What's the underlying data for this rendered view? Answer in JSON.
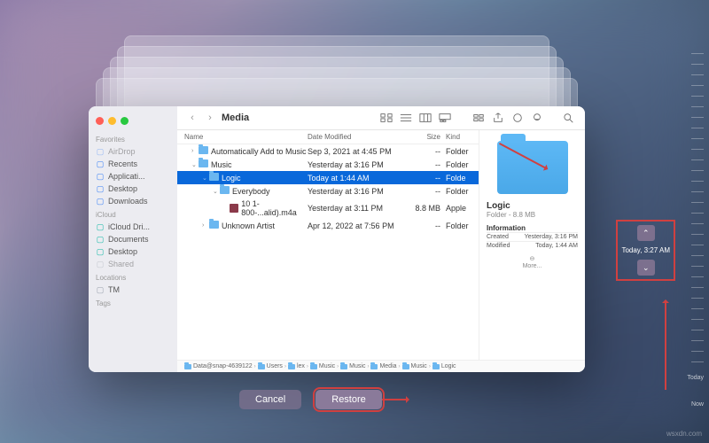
{
  "window_title": "Media",
  "traffic": {
    "close": "#ff5f57",
    "min": "#febc2e",
    "max": "#28c840"
  },
  "sidebar": {
    "favorites_head": "Favorites",
    "favorites": [
      {
        "label": "AirDrop",
        "color": "#3b82f6",
        "dim": true
      },
      {
        "label": "Recents",
        "color": "#3b82f6"
      },
      {
        "label": "Applicati...",
        "color": "#3b82f6"
      },
      {
        "label": "Desktop",
        "color": "#3b82f6"
      },
      {
        "label": "Downloads",
        "color": "#3b82f6"
      }
    ],
    "icloud_head": "iCloud",
    "icloud": [
      {
        "label": "iCloud Dri...",
        "color": "#14b8a6"
      },
      {
        "label": "Documents",
        "color": "#14b8a6"
      },
      {
        "label": "Desktop",
        "color": "#14b8a6"
      },
      {
        "label": "Shared",
        "color": "#9ca3af",
        "dim": true
      }
    ],
    "locations_head": "Locations",
    "locations": [
      {
        "label": "TM",
        "color": "#9ca3af"
      }
    ],
    "tags_head": "Tags"
  },
  "columns": {
    "name": "Name",
    "date": "Date Modified",
    "size": "Size",
    "kind": "Kind"
  },
  "rows": [
    {
      "indent": 0,
      "tri": "›",
      "type": "folder",
      "name": "Automatically Add to Music",
      "date": "Sep 3, 2021 at 4:45 PM",
      "size": "--",
      "kind": "Folder"
    },
    {
      "indent": 0,
      "tri": "⌄",
      "type": "folder",
      "name": "Music",
      "date": "Yesterday at 3:16 PM",
      "size": "--",
      "kind": "Folder"
    },
    {
      "indent": 1,
      "tri": "⌄",
      "type": "folder",
      "name": "Logic",
      "date": "Today at 1:44 AM",
      "size": "--",
      "kind": "Folde",
      "sel": true
    },
    {
      "indent": 2,
      "tri": "⌄",
      "type": "folder",
      "name": "Everybody",
      "date": "Yesterday at 3:16 PM",
      "size": "--",
      "kind": "Folder"
    },
    {
      "indent": 3,
      "tri": "",
      "type": "audio",
      "name": "10 1-800-...alid).m4a",
      "date": "Yesterday at 3:11 PM",
      "size": "8.8 MB",
      "kind": "Apple"
    },
    {
      "indent": 1,
      "tri": "›",
      "type": "folder",
      "name": "Unknown Artist",
      "date": "Apr 12, 2022 at 7:56 PM",
      "size": "--",
      "kind": "Folder"
    }
  ],
  "preview": {
    "name": "Logic",
    "sub": "Folder - 8.8 MB",
    "info_head": "Information",
    "created_k": "Created",
    "created_v": "Yesterday, 3:16 PM",
    "modified_k": "Modified",
    "modified_v": "Today, 1:44 AM",
    "more": "More..."
  },
  "pathbar": [
    "Data@snap-4639122",
    "Users",
    "lex",
    "Music",
    "Music",
    "Media",
    "Music",
    "Logic"
  ],
  "buttons": {
    "cancel": "Cancel",
    "restore": "Restore"
  },
  "timeline": {
    "label": "Today, 3:27 AM",
    "today": "Today",
    "now": "Now"
  },
  "watermark": "wsxdn.com"
}
